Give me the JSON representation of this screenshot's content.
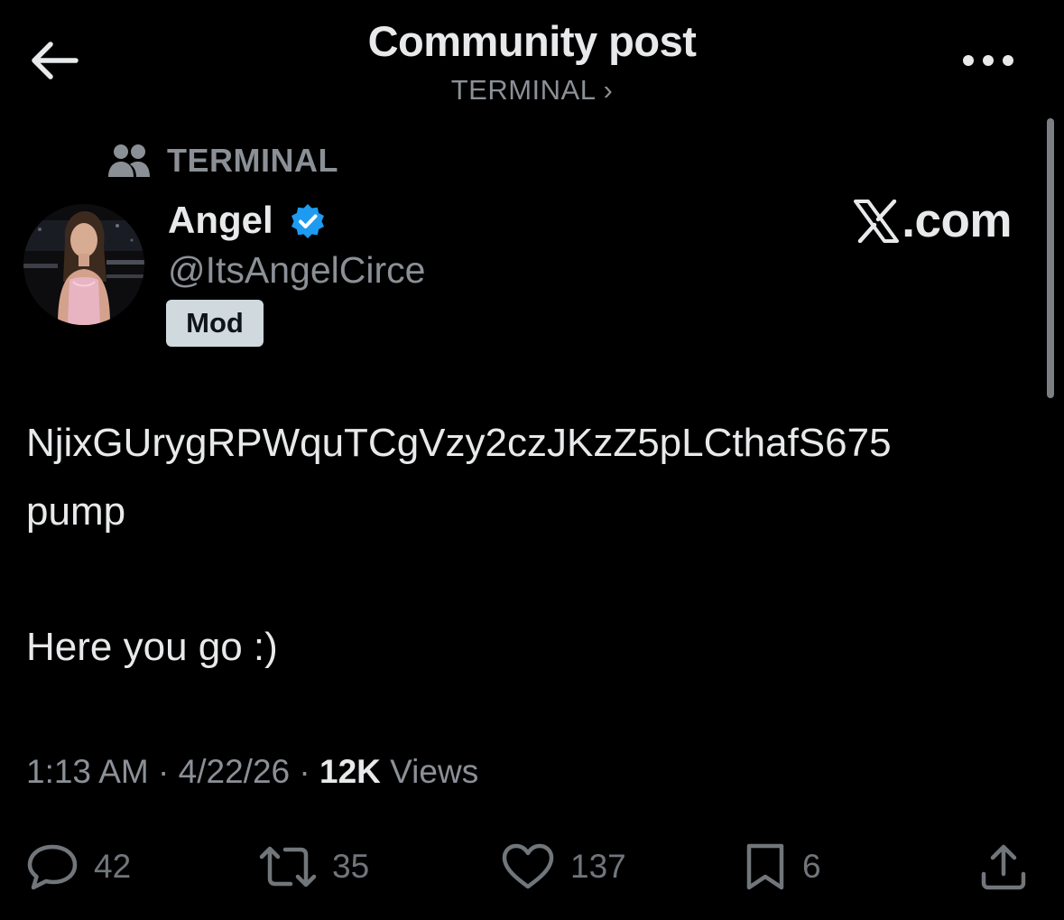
{
  "header": {
    "title": "Community post",
    "subtitle": "TERMINAL ›"
  },
  "community": {
    "name": "TERMINAL",
    "icon": "community-people-icon"
  },
  "author": {
    "name": "Angel",
    "verified": true,
    "handle": "@ItsAngelCirce",
    "badge": "Mod",
    "avatar_icon": "profile-photo"
  },
  "source": {
    "logo_text": ".com",
    "logo_icon": "x-logo-icon"
  },
  "post": {
    "line1": "NjixGUrygRPWquTCgVzy2czJKzZ5pLCthafS675",
    "line2": "pump",
    "line3": "Here you go :)"
  },
  "meta": {
    "time": "1:13 AM",
    "sep1": " · ",
    "date": "4/22/26",
    "sep2": " · ",
    "views_count": "12K",
    "views_label": " Views"
  },
  "actions": {
    "replies": "42",
    "reposts": "35",
    "likes": "137",
    "bookmarks": "6"
  },
  "colors": {
    "background": "#000000",
    "text": "#e7e9ea",
    "secondary": "#8b9096",
    "verified": "#1d9bf0",
    "badge_bg": "#cfd9de"
  }
}
